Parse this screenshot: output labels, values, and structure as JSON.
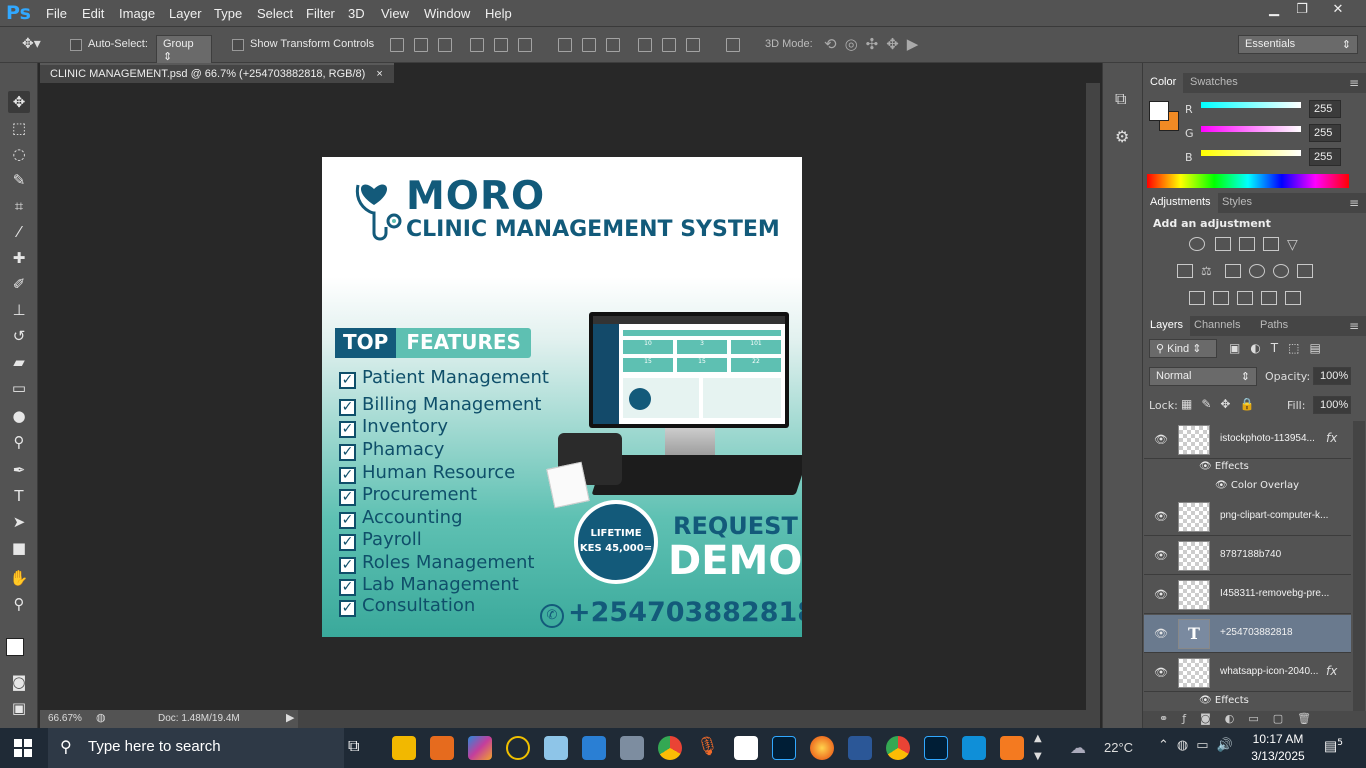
{
  "app": {
    "logo": "Ps",
    "menu": [
      "File",
      "Edit",
      "Image",
      "Layer",
      "Type",
      "Select",
      "Filter",
      "3D",
      "View",
      "Window",
      "Help"
    ]
  },
  "options": {
    "auto_select_label": "Auto-Select:",
    "auto_select_value": "Group",
    "show_transform_label": "Show Transform Controls",
    "mode3d_label": "3D Mode:",
    "workspace": "Essentials"
  },
  "document": {
    "tab_title": "CLINIC MANAGEMENT.psd @ 66.7% (+254703882818, RGB/8)",
    "close": "×",
    "zoom": "66.67%",
    "doc_size": "Doc: 1.48M/19.4M"
  },
  "artwork": {
    "brand": "MORO",
    "subtitle": "CLINIC MANAGEMENT SYSTEM",
    "top": "TOP",
    "features_word": "FEATURES",
    "features": [
      "Patient Management",
      "Billing Management",
      "Inventory",
      "Phamacy",
      "Human Resource",
      "Procurement",
      "Accounting",
      "Payroll",
      "Roles Management",
      "Lab Management",
      "Consultation"
    ],
    "badge_line1": "LIFETIME",
    "badge_line2": "KES 45,000=",
    "request": "REQUEST",
    "demo": "DEMO",
    "phone": "+254703882818",
    "screen_stats": [
      "10",
      "3",
      "101",
      "15",
      "15",
      "22"
    ]
  },
  "color_panel": {
    "tabs": [
      "Color",
      "Swatches"
    ],
    "r_label": "R",
    "g_label": "G",
    "b_label": "B",
    "r": "255",
    "g": "255",
    "b": "255"
  },
  "adjust_panel": {
    "tabs": [
      "Adjustments",
      "Styles"
    ],
    "heading": "Add an adjustment"
  },
  "layers_panel": {
    "tabs": [
      "Layers",
      "Channels",
      "Paths"
    ],
    "kind": "Kind",
    "blend": "Normal",
    "opacity_label": "Opacity:",
    "opacity": "100%",
    "lock_label": "Lock:",
    "fill_label": "Fill:",
    "fill": "100%",
    "layers": [
      {
        "name": "istockphoto-113954...",
        "fx": "fx"
      },
      {
        "name": "png-clipart-computer-k..."
      },
      {
        "name": "8787188b740"
      },
      {
        "name": "I458311-removebg-pre..."
      },
      {
        "name": "+254703882818"
      },
      {
        "name": "whatsapp-icon-2040...",
        "fx": "fx"
      }
    ],
    "effects_label": "Effects",
    "color_overlay_label": "Color Overlay",
    "effects_label2": "Effects"
  },
  "taskbar": {
    "search_placeholder": "Type here to search",
    "weather": "22°C",
    "time": "10:17 AM",
    "date": "3/13/2025",
    "notifications": "5"
  }
}
